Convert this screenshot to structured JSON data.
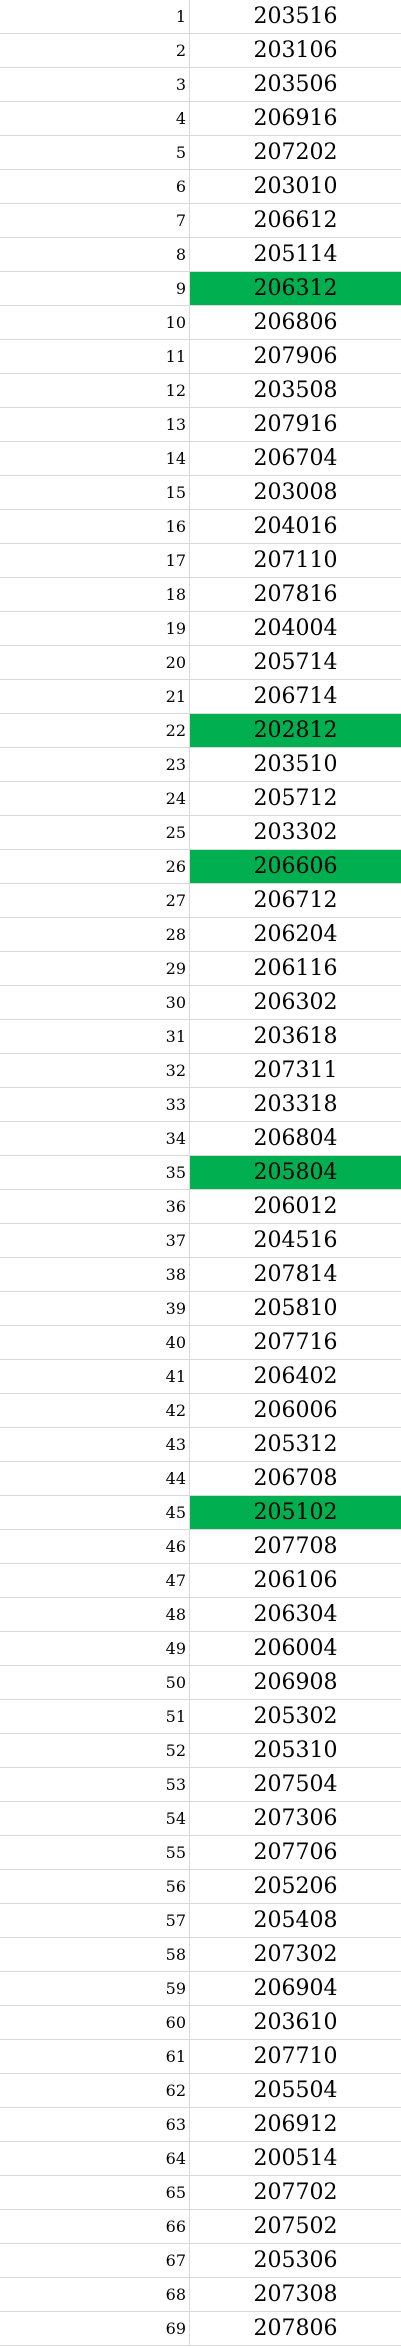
{
  "highlight_color": "#00b050",
  "rows": [
    {
      "index": "1",
      "value": "203516",
      "highlighted": false
    },
    {
      "index": "2",
      "value": "203106",
      "highlighted": false
    },
    {
      "index": "3",
      "value": "203506",
      "highlighted": false
    },
    {
      "index": "4",
      "value": "206916",
      "highlighted": false
    },
    {
      "index": "5",
      "value": "207202",
      "highlighted": false
    },
    {
      "index": "6",
      "value": "203010",
      "highlighted": false
    },
    {
      "index": "7",
      "value": "206612",
      "highlighted": false
    },
    {
      "index": "8",
      "value": "205114",
      "highlighted": false
    },
    {
      "index": "9",
      "value": "206312",
      "highlighted": true
    },
    {
      "index": "10",
      "value": "206806",
      "highlighted": false
    },
    {
      "index": "11",
      "value": "207906",
      "highlighted": false
    },
    {
      "index": "12",
      "value": "203508",
      "highlighted": false
    },
    {
      "index": "13",
      "value": "207916",
      "highlighted": false
    },
    {
      "index": "14",
      "value": "206704",
      "highlighted": false
    },
    {
      "index": "15",
      "value": "203008",
      "highlighted": false
    },
    {
      "index": "16",
      "value": "204016",
      "highlighted": false
    },
    {
      "index": "17",
      "value": "207110",
      "highlighted": false
    },
    {
      "index": "18",
      "value": "207816",
      "highlighted": false
    },
    {
      "index": "19",
      "value": "204004",
      "highlighted": false
    },
    {
      "index": "20",
      "value": "205714",
      "highlighted": false
    },
    {
      "index": "21",
      "value": "206714",
      "highlighted": false
    },
    {
      "index": "22",
      "value": "202812",
      "highlighted": true
    },
    {
      "index": "23",
      "value": "203510",
      "highlighted": false
    },
    {
      "index": "24",
      "value": "205712",
      "highlighted": false
    },
    {
      "index": "25",
      "value": "203302",
      "highlighted": false
    },
    {
      "index": "26",
      "value": "206606",
      "highlighted": true
    },
    {
      "index": "27",
      "value": "206712",
      "highlighted": false
    },
    {
      "index": "28",
      "value": "206204",
      "highlighted": false
    },
    {
      "index": "29",
      "value": "206116",
      "highlighted": false
    },
    {
      "index": "30",
      "value": "206302",
      "highlighted": false
    },
    {
      "index": "31",
      "value": "203618",
      "highlighted": false
    },
    {
      "index": "32",
      "value": "207311",
      "highlighted": false
    },
    {
      "index": "33",
      "value": "203318",
      "highlighted": false
    },
    {
      "index": "34",
      "value": "206804",
      "highlighted": false
    },
    {
      "index": "35",
      "value": "205804",
      "highlighted": true
    },
    {
      "index": "36",
      "value": "206012",
      "highlighted": false
    },
    {
      "index": "37",
      "value": "204516",
      "highlighted": false
    },
    {
      "index": "38",
      "value": "207814",
      "highlighted": false
    },
    {
      "index": "39",
      "value": "205810",
      "highlighted": false
    },
    {
      "index": "40",
      "value": "207716",
      "highlighted": false
    },
    {
      "index": "41",
      "value": "206402",
      "highlighted": false
    },
    {
      "index": "42",
      "value": "206006",
      "highlighted": false
    },
    {
      "index": "43",
      "value": "205312",
      "highlighted": false
    },
    {
      "index": "44",
      "value": "206708",
      "highlighted": false
    },
    {
      "index": "45",
      "value": "205102",
      "highlighted": true
    },
    {
      "index": "46",
      "value": "207708",
      "highlighted": false
    },
    {
      "index": "47",
      "value": "206106",
      "highlighted": false
    },
    {
      "index": "48",
      "value": "206304",
      "highlighted": false
    },
    {
      "index": "49",
      "value": "206004",
      "highlighted": false
    },
    {
      "index": "50",
      "value": "206908",
      "highlighted": false
    },
    {
      "index": "51",
      "value": "205302",
      "highlighted": false
    },
    {
      "index": "52",
      "value": "205310",
      "highlighted": false
    },
    {
      "index": "53",
      "value": "207504",
      "highlighted": false
    },
    {
      "index": "54",
      "value": "207306",
      "highlighted": false
    },
    {
      "index": "55",
      "value": "207706",
      "highlighted": false
    },
    {
      "index": "56",
      "value": "205206",
      "highlighted": false
    },
    {
      "index": "57",
      "value": "205408",
      "highlighted": false
    },
    {
      "index": "58",
      "value": "207302",
      "highlighted": false
    },
    {
      "index": "59",
      "value": "206904",
      "highlighted": false
    },
    {
      "index": "60",
      "value": "203610",
      "highlighted": false
    },
    {
      "index": "61",
      "value": "207710",
      "highlighted": false
    },
    {
      "index": "62",
      "value": "205504",
      "highlighted": false
    },
    {
      "index": "63",
      "value": "206912",
      "highlighted": false
    },
    {
      "index": "64",
      "value": "200514",
      "highlighted": false
    },
    {
      "index": "65",
      "value": "207702",
      "highlighted": false
    },
    {
      "index": "66",
      "value": "207502",
      "highlighted": false
    },
    {
      "index": "67",
      "value": "205306",
      "highlighted": false
    },
    {
      "index": "68",
      "value": "207308",
      "highlighted": false
    },
    {
      "index": "69",
      "value": "207806",
      "highlighted": false
    }
  ]
}
